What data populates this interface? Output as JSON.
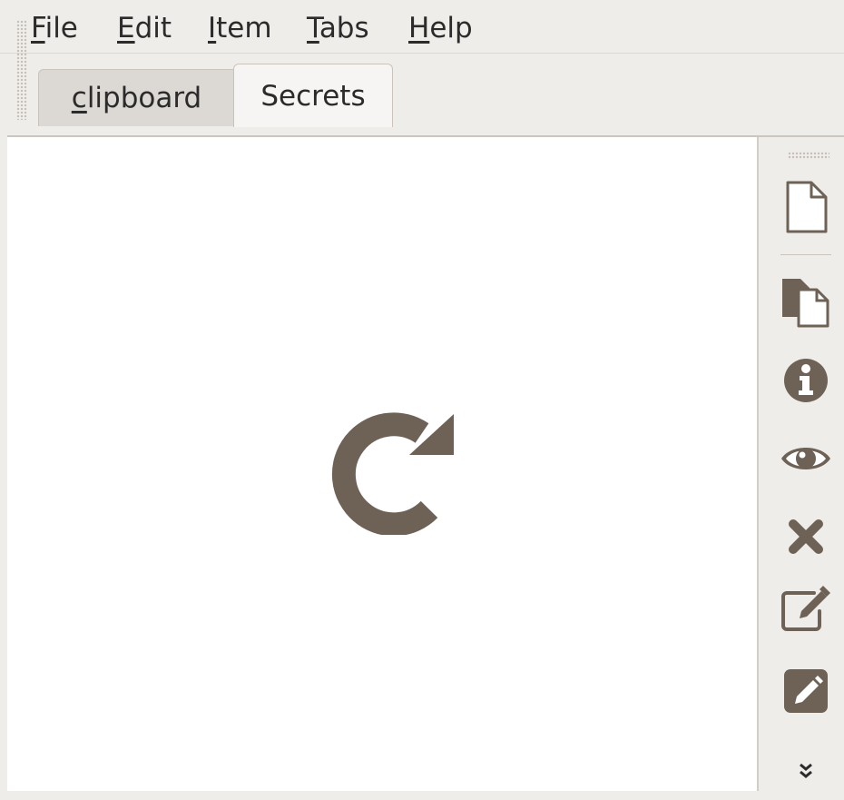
{
  "menubar": {
    "items": [
      {
        "mnemonic": "F",
        "rest": "ile"
      },
      {
        "mnemonic": "E",
        "rest": "dit"
      },
      {
        "mnemonic": "I",
        "rest": "tem"
      },
      {
        "mnemonic": "T",
        "rest": "abs"
      },
      {
        "mnemonic": "H",
        "rest": "elp"
      }
    ]
  },
  "tabs": [
    {
      "mnemonic": "c",
      "rest": "lipboard",
      "active": false
    },
    {
      "label": "Secrets",
      "active": true
    }
  ],
  "content": {
    "state_icon": "reload-icon"
  },
  "toolbar": {
    "buttons": [
      {
        "icon": "new-item-icon"
      },
      {
        "icon": "copy-icon"
      },
      {
        "icon": "info-icon"
      },
      {
        "icon": "eye-icon"
      },
      {
        "icon": "delete-icon"
      },
      {
        "icon": "edit-icon"
      },
      {
        "icon": "edit-notes-icon"
      },
      {
        "icon": "more-chevron-icon"
      }
    ]
  },
  "colors": {
    "icon": "#6e6256",
    "window_bg": "#efedea",
    "content_bg": "#ffffff"
  }
}
